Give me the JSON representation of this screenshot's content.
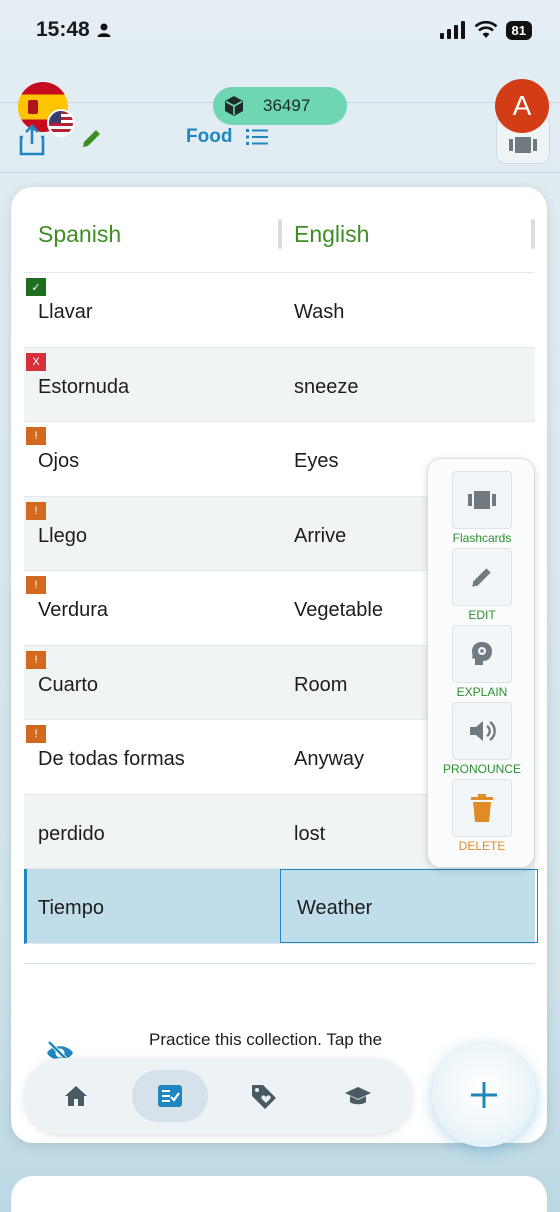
{
  "status_bar": {
    "time": "15:48",
    "battery": "81"
  },
  "header": {
    "points": "36497",
    "collection_title": "Food",
    "avatar_initial": "A"
  },
  "table": {
    "columns": {
      "source": "Spanish",
      "target": "English"
    },
    "rows": [
      {
        "source": "Llavar",
        "target": "Wash",
        "status": "correct",
        "badge": "✓"
      },
      {
        "source": "Estornuda",
        "target": "sneeze",
        "status": "wrong",
        "badge": "X"
      },
      {
        "source": "Ojos",
        "target": "Eyes",
        "status": "warning",
        "badge": "!"
      },
      {
        "source": "Llego",
        "target": "Arrive",
        "status": "warning",
        "badge": "!"
      },
      {
        "source": "Verdura",
        "target": "Vegetable",
        "status": "warning",
        "badge": "!"
      },
      {
        "source": "Cuarto",
        "target": "Room",
        "status": "warning",
        "badge": "!"
      },
      {
        "source": "De todas formas",
        "target": "Anyway",
        "status": "warning",
        "badge": "!"
      },
      {
        "source": "perdido",
        "target": "lost",
        "status": "none",
        "badge": ""
      },
      {
        "source": "Tiempo",
        "target": "Weather",
        "status": "none",
        "badge": "",
        "selected": true
      }
    ]
  },
  "context_menu": {
    "flashcards": "Flashcards",
    "edit": "EDIT",
    "explain": "EXPLAIN",
    "pronounce": "PRONOUNCE",
    "delete": "DELETE"
  },
  "practice_text": "Practice this collection. Tap the",
  "nav": {
    "items": [
      "home-icon",
      "list-check-icon",
      "tag-heart-icon",
      "graduation-cap-icon"
    ],
    "active": "list-check-icon",
    "fab": "plus-icon"
  },
  "colors": {
    "accent_blue": "#1f86c0",
    "green_text": "#3e8e22",
    "points_pill": "#6fd6b4",
    "avatar": "#d33d16",
    "delete_orange": "#e08a28"
  }
}
